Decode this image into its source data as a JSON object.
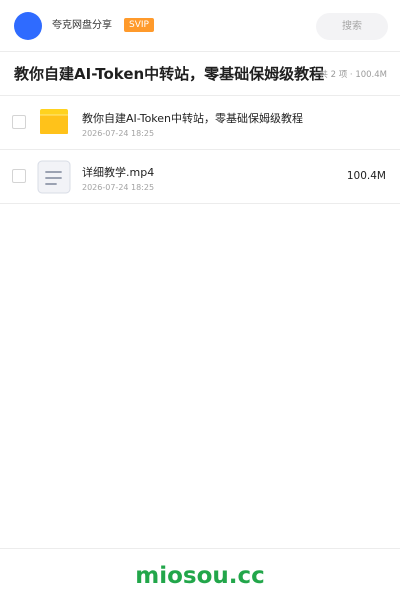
{
  "header": {
    "user_name": "夸克网盘分享",
    "badge": "SVIP",
    "search_placeholder": "搜索",
    "avatar_color": "#2f6bff",
    "badge_color": "#ff9a2b"
  },
  "title_row": {
    "title": "教你自建AI-Token中转站，零基础保姆级教程",
    "summary": "共 2 项 · 100.4M"
  },
  "files": [
    {
      "name": "教你自建AI-Token中转站，零基础保姆级教程",
      "date": "2026-07-24 18:25",
      "size": "",
      "icon": "folder-icon",
      "icon_color": "#ffc21a"
    },
    {
      "name": "详细教学.mp4",
      "date": "2026-07-24 18:25",
      "size": "100.4M",
      "icon": "document-icon",
      "icon_color": "#f2f3f7"
    }
  ],
  "footer": {
    "brand": "miosou.cc",
    "brand_color": "#22a64a"
  }
}
